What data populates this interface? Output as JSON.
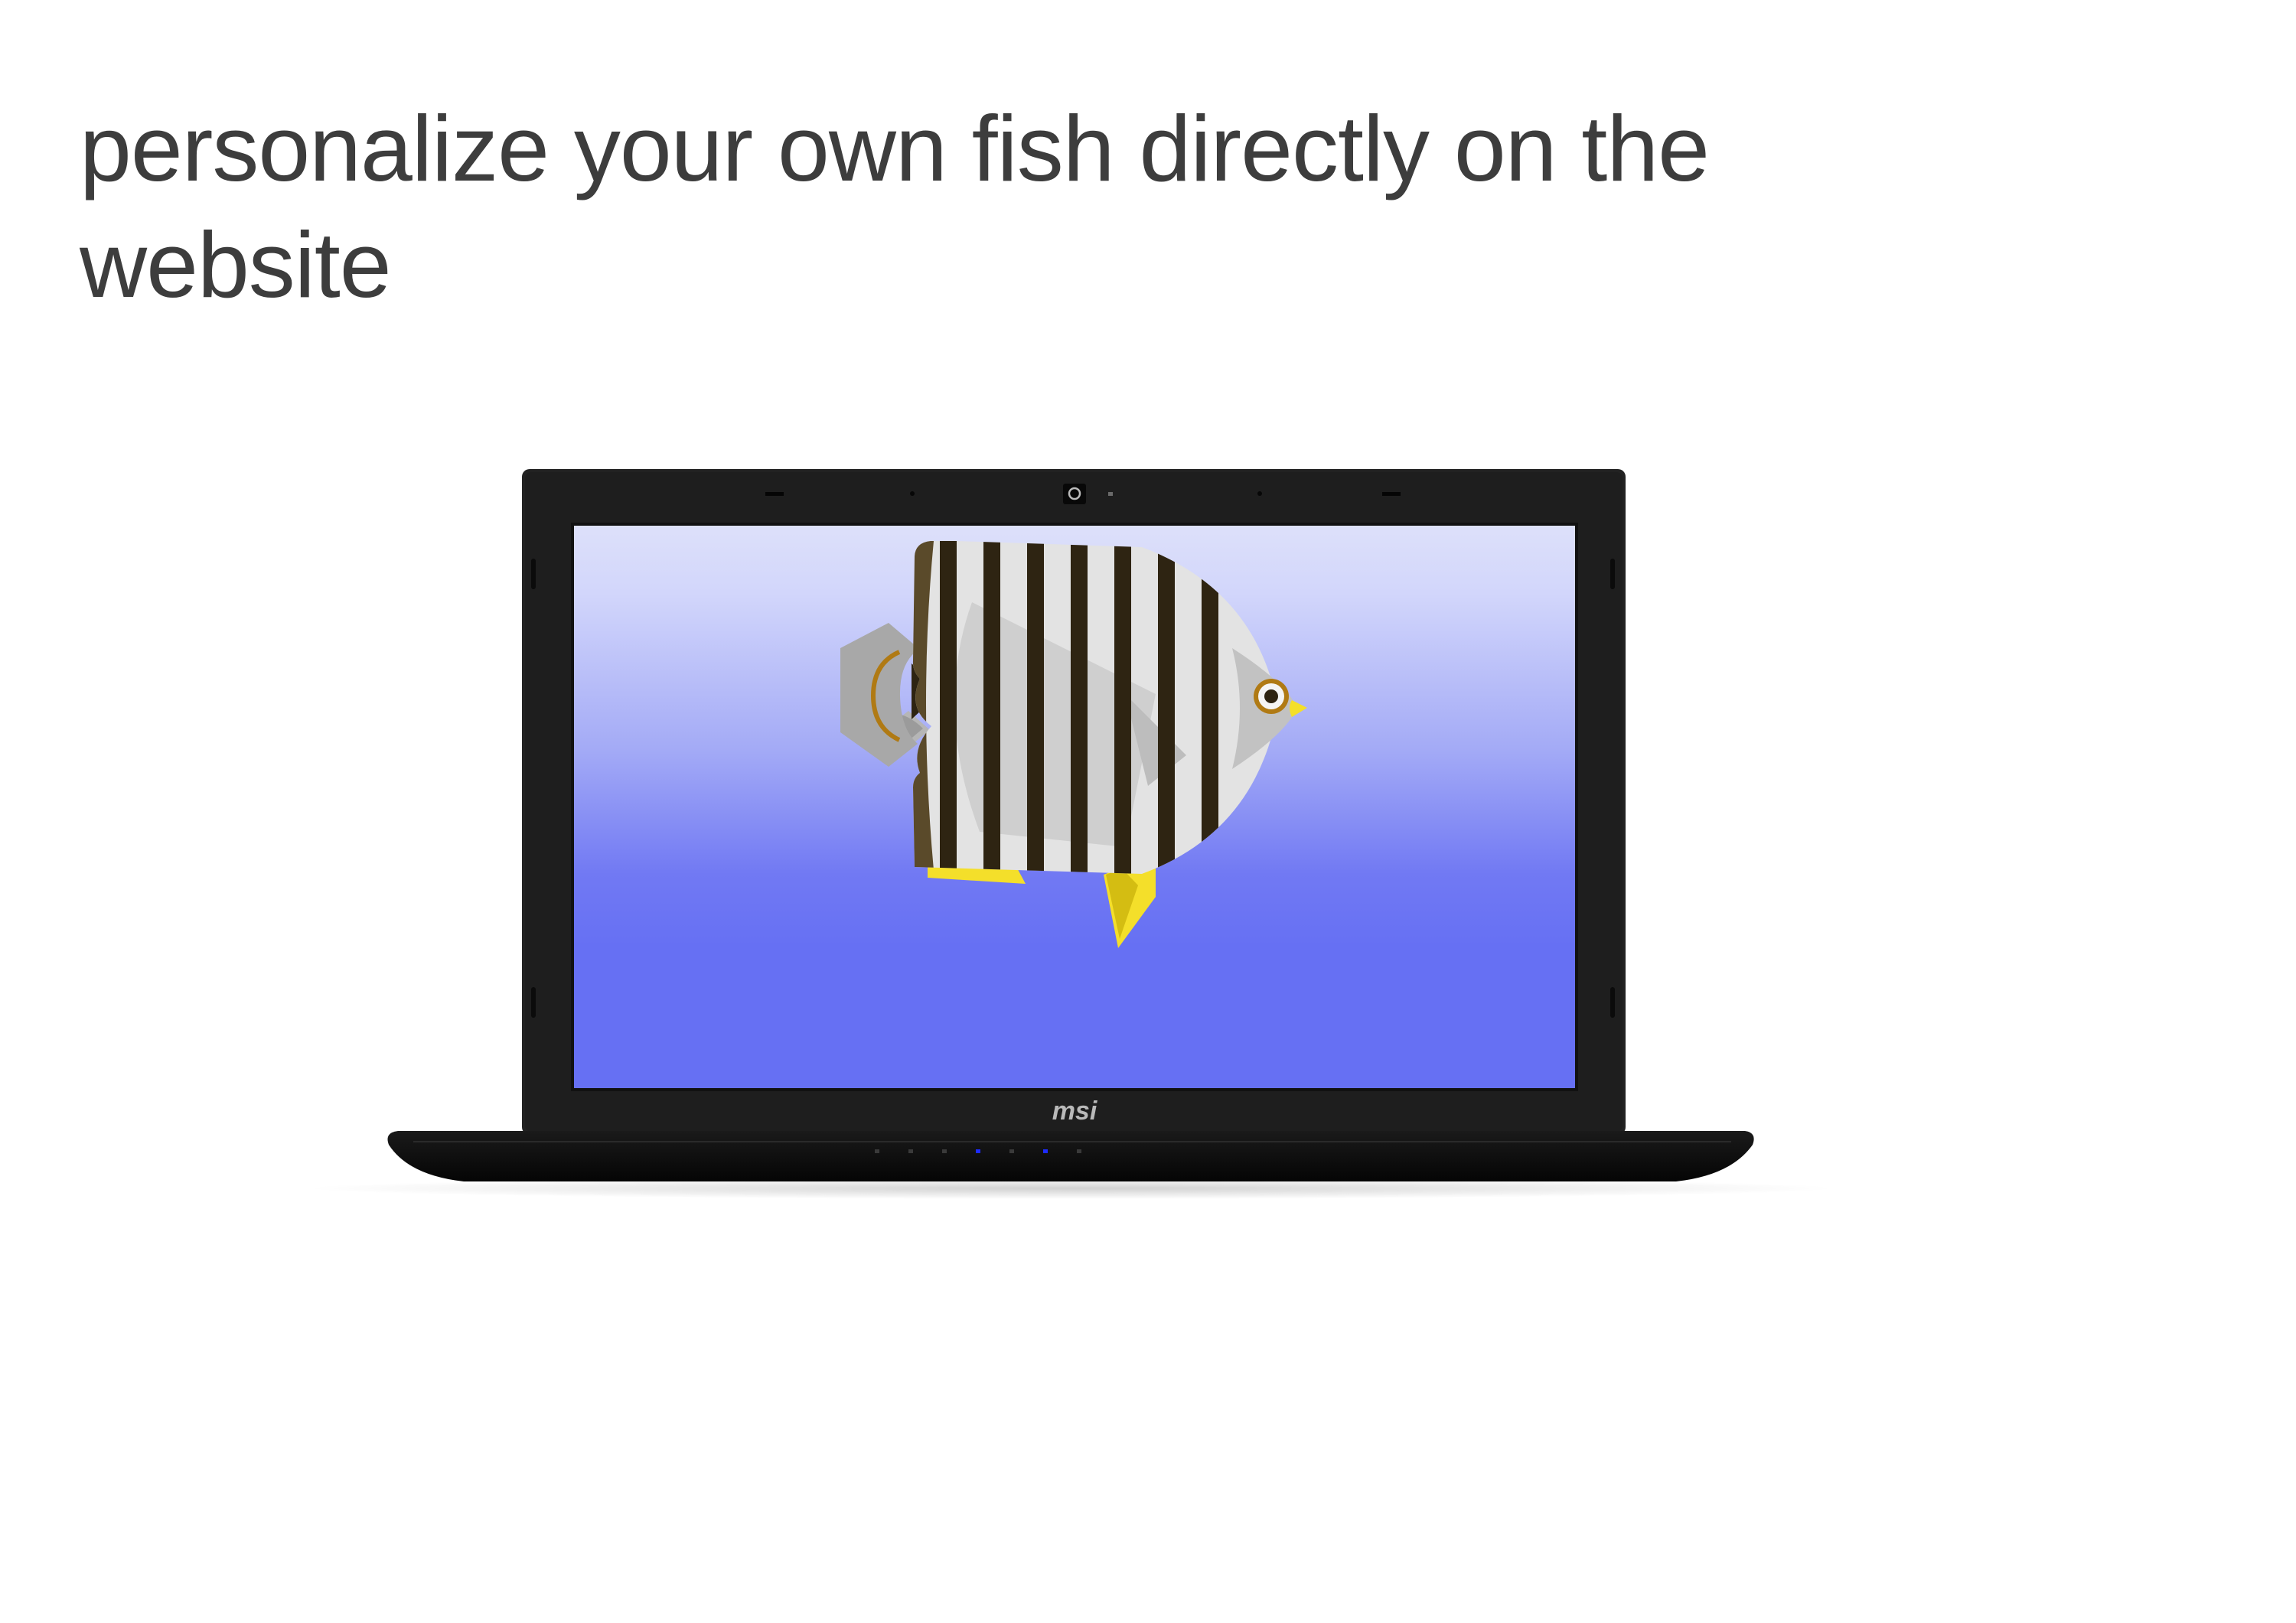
{
  "headline": {
    "text": "personalize your own fish directly on the website"
  },
  "laptop": {
    "brand_logo": "msi",
    "camera_icon": "webcam-icon",
    "indicator_lights": [
      "off",
      "off",
      "off",
      "on",
      "off",
      "on",
      "off"
    ]
  },
  "screen": {
    "gradient_top": "#dde0fa",
    "gradient_bottom": "#6670f3",
    "fish_icon": "butterflyfish-illustration"
  },
  "colors": {
    "text": "#3d3d3d",
    "bezel": "#1f1f1f",
    "fish_stripe": "#2e2412",
    "fish_body": "#e3e3e3",
    "fish_fin_yellow": "#f4df2a",
    "indicator_blue": "#1d2bff"
  }
}
